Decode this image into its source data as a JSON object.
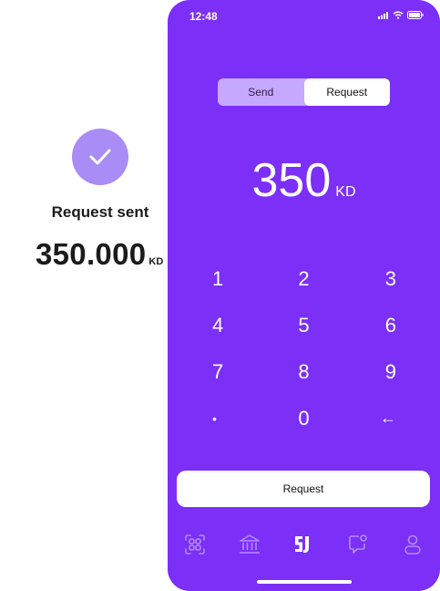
{
  "confirmation": {
    "title": "Request sent",
    "amount": "350.000",
    "currency": "KD",
    "icon": "check-icon"
  },
  "status_bar": {
    "time": "12:48",
    "icons": [
      "signal-icon",
      "wifi-icon",
      "battery-icon"
    ]
  },
  "segmented": {
    "options": [
      {
        "label": "Send",
        "selected": false
      },
      {
        "label": "Request",
        "selected": true
      }
    ]
  },
  "amount": {
    "value": "350",
    "currency": "KD"
  },
  "keypad": {
    "rows": [
      [
        "1",
        "2",
        "3"
      ],
      [
        "4",
        "5",
        "6"
      ],
      [
        "7",
        "8",
        "9"
      ],
      [
        "•",
        "0",
        "←"
      ]
    ]
  },
  "primary_button": {
    "label": "Request"
  },
  "tabbar": {
    "items": [
      "scan-icon",
      "bank-icon",
      "app-logo-icon",
      "chat-icon",
      "profile-icon"
    ],
    "active": "app-logo-icon"
  },
  "colors": {
    "brand": "#7b2ff7",
    "segment_bg": "#c7a8ff",
    "check_circle": "#a98cf5",
    "tab_inactive": "#b48cff"
  }
}
